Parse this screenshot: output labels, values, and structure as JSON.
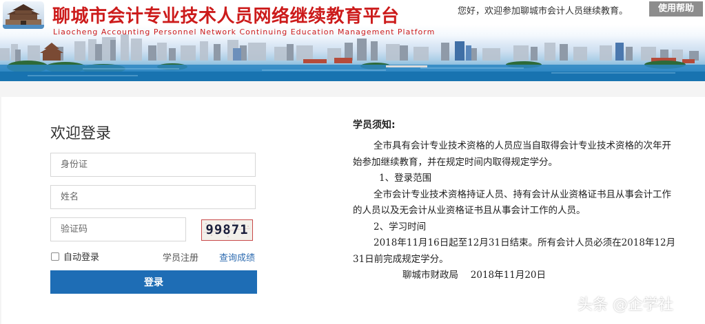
{
  "header": {
    "title": "聊城市会计专业技术人员网络继续教育平台",
    "subtitle": "Liaocheng Accounting Personnel Network Continuing Education Management Platform",
    "welcome": "您好，欢迎参加聊城市会计人员继续教育。",
    "help_label": "使用帮助"
  },
  "login": {
    "title": "欢迎登录",
    "id_placeholder": "身份证",
    "name_placeholder": "姓名",
    "captcha_placeholder": "验证码",
    "captcha_code": "99871",
    "remember_label": "自动登录",
    "register_link": "学员注册",
    "query_link": "查询成绩",
    "submit_label": "登录"
  },
  "notice": {
    "heading": "学员须知:",
    "intro": "全市具有会计专业技术资格的人员应当自取得会计专业技术资格的次年开始参加继续教育，并在规定时间内取得规定学分。",
    "section1_title": "1、登录范围",
    "section1_text": "全市会计专业技术资格持证人员、持有会计从业资格证书且从事会计工作的人员以及无会计从业资格证书且从事会计工作的人员。",
    "section2_title": "2、学习时间",
    "section2_text": "2018年11月16日起至12月31日结束。所有会计人员必须在2018年12月31日前完成规定学分。",
    "signature": "聊城市财政局　 2018年11月20日"
  },
  "watermark": "头条 @企学社",
  "colors": {
    "title_red": "#cc1b1b",
    "button_blue": "#1e6db5",
    "link_blue": "#2d6bb0",
    "help_gray": "#8d8d8d"
  },
  "icons": {
    "logo": "city-gate-logo",
    "checkbox": "checkbox-unchecked"
  }
}
